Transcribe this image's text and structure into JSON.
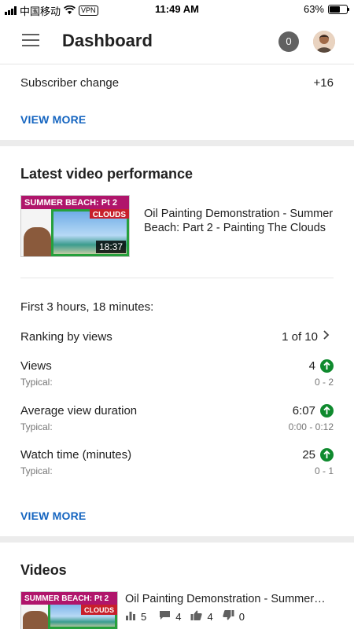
{
  "status_bar": {
    "carrier": "中国移动",
    "vpn": "VPN",
    "time": "11:49 AM",
    "battery": "63%",
    "battery_level": 0.63
  },
  "header": {
    "title": "Dashboard",
    "notification_count": "0"
  },
  "channel_analytics": {
    "subscriber_label": "Subscriber change",
    "subscriber_value": "+16",
    "view_more": "VIEW MORE"
  },
  "latest_video": {
    "heading": "Latest video performance",
    "thumbnail": {
      "banner": "SUMMER BEACH: Pt 2",
      "tag": "CLOUDS",
      "duration": "18:37"
    },
    "title": "Oil Painting Demonstration - Summer Beach: Part 2 - Painting The Clouds",
    "period": "First 3 hours, 18 minutes:",
    "ranking_label": "Ranking by views",
    "ranking_value": "1 of 10",
    "metrics": [
      {
        "label": "Views",
        "value": "4",
        "typical_label": "Typical:",
        "typical_value": "0 - 2"
      },
      {
        "label": "Average view duration",
        "value": "6:07",
        "typical_label": "Typical:",
        "typical_value": "0:00 - 0:12"
      },
      {
        "label": "Watch time (minutes)",
        "value": "25",
        "typical_label": "Typical:",
        "typical_value": "0 - 1"
      }
    ],
    "view_more": "VIEW MORE"
  },
  "videos": {
    "heading": "Videos",
    "items": [
      {
        "title": "Oil Painting Demonstration - Summer…",
        "thumbnail": {
          "banner": "SUMMER BEACH: Pt 2",
          "tag": "CLOUDS"
        },
        "views": "5",
        "comments": "4",
        "likes": "4",
        "dislikes": "0"
      }
    ]
  },
  "colors": {
    "accent_link": "#1565c0",
    "positive": "#0f8a2e",
    "badge": "#616161"
  }
}
